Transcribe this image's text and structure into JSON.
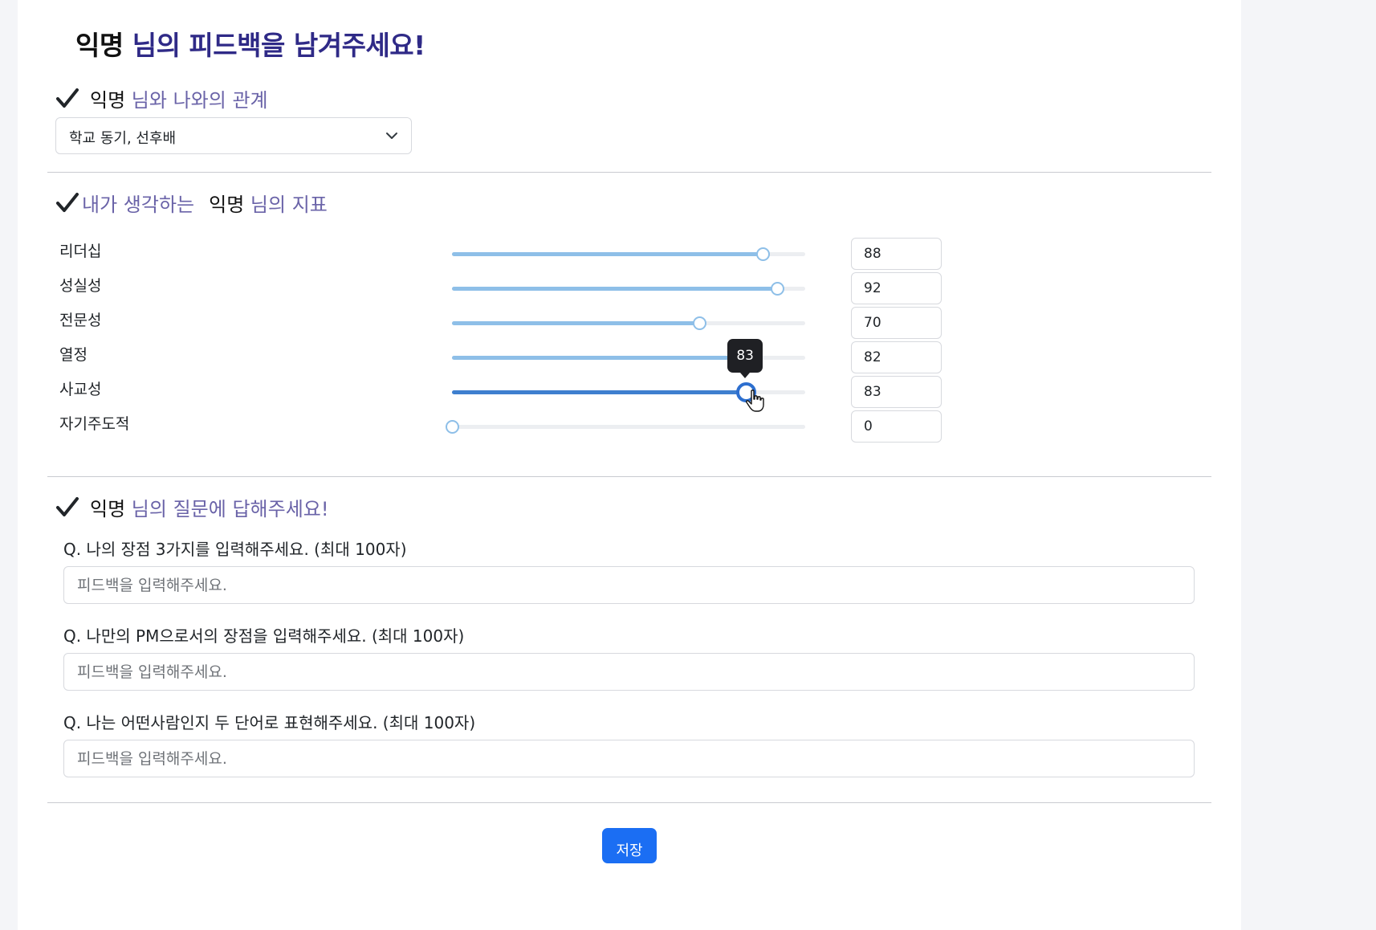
{
  "header": {
    "name": "익명",
    "title_rest": " 님의 피드백을 남겨주세요!"
  },
  "relationship": {
    "name": "익명",
    "heading_rest": " 님와 나와의 관계",
    "selected": "학교 동기, 선후배",
    "icon": "chevron-down-icon"
  },
  "metrics": {
    "heading_prefix": "내가 생각하는",
    "name": "익명",
    "heading_rest": " 님의 지표",
    "items": [
      {
        "label": "리더십",
        "value": 88
      },
      {
        "label": "성실성",
        "value": 92
      },
      {
        "label": "전문성",
        "value": 70
      },
      {
        "label": "열정",
        "value": 82
      },
      {
        "label": "사교성",
        "value": 83
      },
      {
        "label": "자기주도적",
        "value": 0
      }
    ],
    "active_index": 4,
    "tooltip": "83",
    "max": 100
  },
  "questions": {
    "name": "익명",
    "heading_rest": " 님의 질문에 답해주세요!",
    "placeholder": "피드백을 입력해주세요.",
    "items": [
      {
        "label": "Q. 나의 장점 3가지를 입력해주세요. (최대 100자)"
      },
      {
        "label": "Q. 나만의 PM으로서의 장점을 입력해주세요. (최대 100자)"
      },
      {
        "label": "Q. 나는 어떤사람인지 두 단어로 표현해주세요. (최대 100자)"
      }
    ]
  },
  "save_label": "저장",
  "colors": {
    "title_purple": "#2f2a87",
    "heading_purple": "#6a63a8",
    "slider_fill": "#8ebfe8",
    "slider_active": "#2d6fcf",
    "button_blue": "#1b6ef3"
  }
}
